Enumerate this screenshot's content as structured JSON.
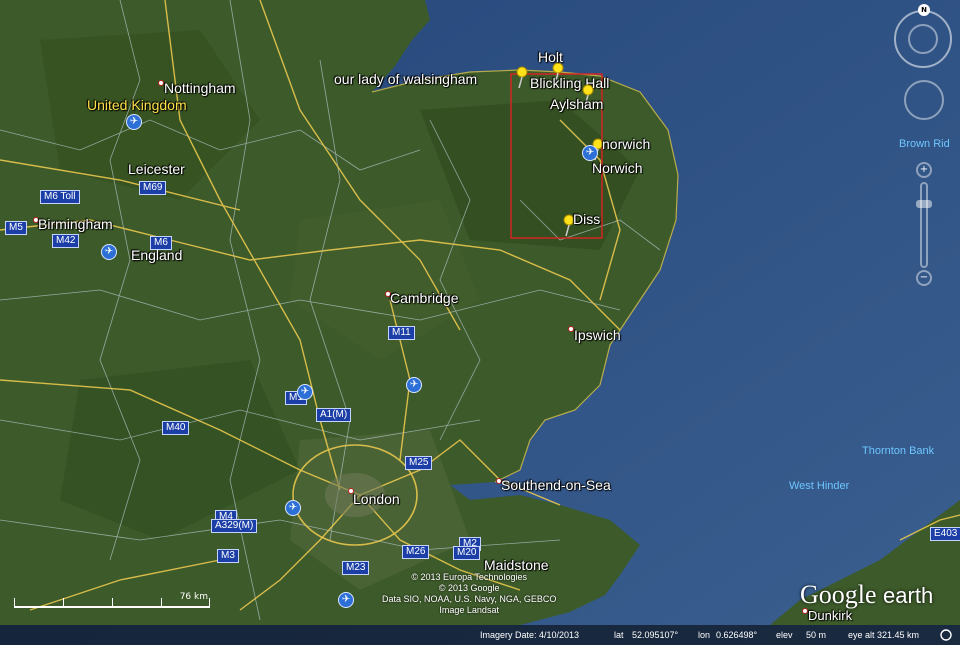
{
  "map": {
    "provider_logo": {
      "brand": "Google",
      "product": "earth"
    },
    "labels": {
      "places": [
        "Nottingham",
        "Leicester",
        "Birmingham",
        "England",
        "Cambridge",
        "Ipswich",
        "London",
        "Southend-on-Sea",
        "Maidstone",
        "Dunkirk",
        "Norwich"
      ],
      "country": "United Kingdom",
      "sea": [
        "Brown Rid",
        "Thornton Bank",
        "West Hinder"
      ]
    },
    "placemarks": [
      {
        "name": "Holt"
      },
      {
        "name": "our lady of walsingham"
      },
      {
        "name": "Blickling Hall"
      },
      {
        "name": "Aylsham"
      },
      {
        "name": "norwich"
      },
      {
        "name": "Diss"
      }
    ],
    "roads": [
      "M6 Toll",
      "M69",
      "M5",
      "M42",
      "M6",
      "M11",
      "M1",
      "A1(M)",
      "M40",
      "M25",
      "M4",
      "A329(M)",
      "M3",
      "M26",
      "M2",
      "M20",
      "M23",
      "E403"
    ],
    "copyright_lines": [
      "© 2013 Europa Technologies",
      "© 2013 Google",
      "Data SIO, NOAA, U.S. Navy, NGA, GEBCO",
      "Image Landsat"
    ],
    "scale_label": "76 km",
    "status": {
      "imagery_date": "Imagery Date: 4/10/2013",
      "lat_label": "lat",
      "lat": "52.095107°",
      "lon_label": "lon",
      "lon": "0.626498°",
      "elev_label": "elev",
      "elev": "50 m",
      "eye_alt": "eye alt 321.45 km"
    },
    "compass_n": "N"
  }
}
